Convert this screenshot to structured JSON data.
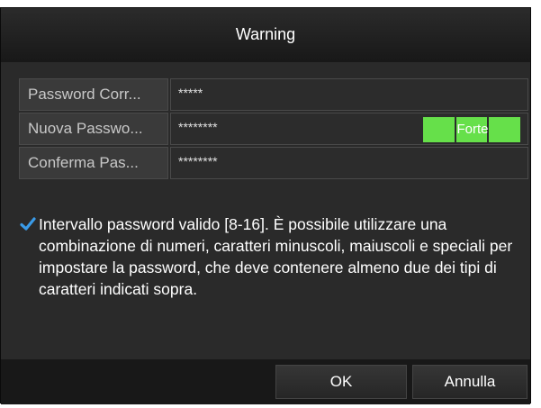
{
  "dialog": {
    "title": "Warning"
  },
  "form": {
    "rows": [
      {
        "label": "Password Corr...",
        "value": "*****"
      },
      {
        "label": "Nuova Passwo...",
        "value": "********"
      },
      {
        "label": "Conferma Pas...",
        "value": "********"
      }
    ],
    "strength": {
      "label": "Forte",
      "color": "#66e04a"
    }
  },
  "note": {
    "icon": "checkmark-icon",
    "text": "Intervallo password valido [8-16]. È possibile utilizzare una combinazione di numeri, caratteri minuscoli, maiuscoli e speciali per impostare la password, che deve contenere almeno due dei tipi di caratteri indicati sopra."
  },
  "buttons": {
    "ok": "OK",
    "cancel": "Annulla"
  }
}
